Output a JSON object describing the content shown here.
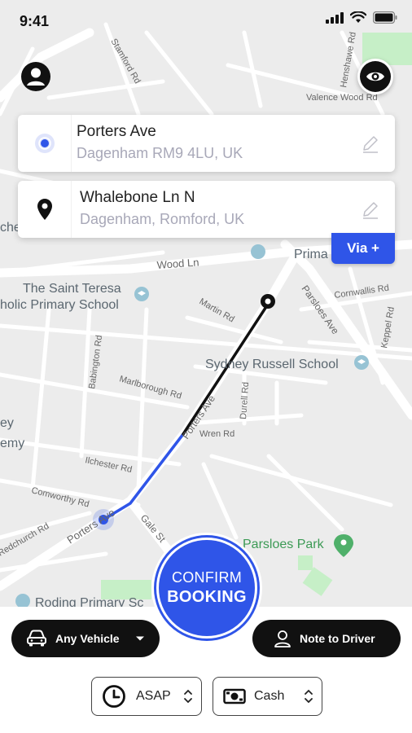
{
  "status_bar": {
    "time": "9:41"
  },
  "map": {
    "street_labels": [
      "Wood Ln",
      "Porters Ave",
      "Parsloes Ave",
      "Gale St",
      "Martin Rd",
      "Babington Rd",
      "Marlborough Rd",
      "Wren Rd",
      "Ilchester Rd",
      "Comworthy Rd",
      "Durell Rd",
      "Cornwallis Rd",
      "Keppel Rd",
      "Valence Wood Rd",
      "Henshawe Rd",
      "Stamford Rd",
      "Redchurch Rd"
    ],
    "poi_labels": [
      "The Saint Teresa",
      "holic Primary School",
      "Sydney Russell School",
      "Parsloes Park",
      "Roding Primary Sc",
      "Prima"
    ],
    "edge_fragments": [
      "ey",
      "emy",
      "che"
    ]
  },
  "pickup": {
    "primary": "Porters Ave",
    "secondary": "Dagenham RM9 4LU, UK"
  },
  "dropoff": {
    "primary": "Whalebone Ln N",
    "secondary": "Dagenham, Romford, UK"
  },
  "via_label": "Via +",
  "confirm": {
    "line1": "CONFIRM",
    "line2": "BOOKING"
  },
  "vehicle_label": "Any Vehicle",
  "note_label": "Note to Driver",
  "time_option": "ASAP",
  "payment_option": "Cash",
  "icons": {
    "profile": "profile-icon",
    "visibility": "eye-icon",
    "pickup": "location-dot-icon",
    "dropoff": "map-pin-icon",
    "edit": "pencil-icon",
    "vehicle": "car-icon",
    "dropdown": "caret-down-icon",
    "note": "user-outline-icon",
    "clock": "clock-icon",
    "cash": "banknote-icon",
    "stepper": "up-down-chevrons-icon"
  },
  "colors": {
    "accent": "#2f55e8",
    "dark": "#111111",
    "park": "#c6efc7",
    "route_completed": "#2f55e8",
    "route_remaining": "#111111"
  }
}
